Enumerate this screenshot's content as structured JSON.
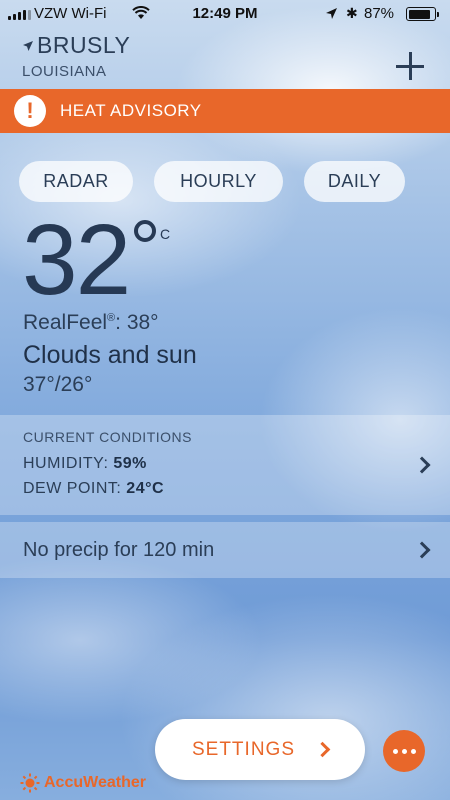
{
  "status_bar": {
    "carrier": "VZW Wi-Fi",
    "time": "12:49 PM",
    "battery_percent": "87%",
    "battery_level": 0.87
  },
  "location": {
    "city": "BRUSLY",
    "state": "LOUISIANA"
  },
  "advisory": {
    "icon_glyph": "!",
    "text": "HEAT ADVISORY"
  },
  "tabs": [
    {
      "label": "RADAR"
    },
    {
      "label": "HOURLY"
    },
    {
      "label": "DAILY"
    }
  ],
  "current": {
    "temperature": "32",
    "unit": "C",
    "realfeel_label": "RealFeel",
    "realfeel_mark": "®",
    "realfeel_value": ": 38°",
    "condition": "Clouds and sun",
    "hi_lo": "37°/26°"
  },
  "current_conditions": {
    "title": "CURRENT CONDITIONS",
    "humidity_label": "HUMIDITY:",
    "humidity_value": "59%",
    "dew_point_label": "DEW POINT:",
    "dew_point_value": "24°C"
  },
  "precip": {
    "text": "No precip for 120 min"
  },
  "bottom": {
    "settings_label": "SETTINGS",
    "brand": "AccuWeather"
  },
  "colors": {
    "accent": "#e8672a",
    "text_dark": "#1f3048",
    "sky_top": "#c9dbef",
    "sky_bottom": "#6f9bd6"
  },
  "icons": [
    "signal-icon",
    "wifi-icon",
    "location-arrow-icon",
    "bluetooth-icon",
    "battery-icon",
    "add-icon",
    "alert-icon",
    "chevron-right-icon",
    "more-icon",
    "accuweather-sun-icon"
  ]
}
